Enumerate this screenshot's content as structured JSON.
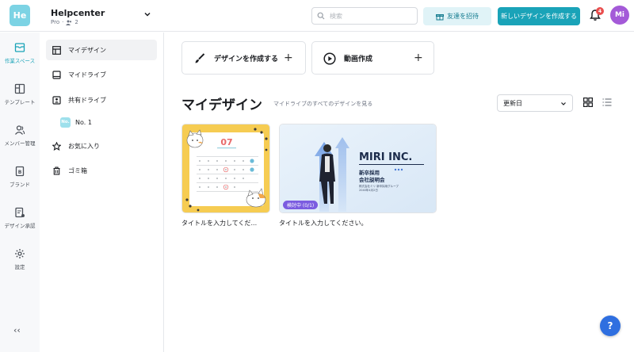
{
  "workspace": {
    "logo": "He",
    "name": "Helpcenter",
    "plan": "Pro",
    "members": "2"
  },
  "header": {
    "search_placeholder": "検索",
    "invite_label": "友達を招待",
    "create_label": "新しいデザインを作成する",
    "notification_count": "4",
    "avatar_initials": "Mi"
  },
  "rail": {
    "items": [
      {
        "label": "作業スペース",
        "icon": "inbox-icon",
        "active": true
      },
      {
        "label": "テンプレート",
        "icon": "template-icon"
      },
      {
        "label": "メンバー管理",
        "icon": "members-icon"
      },
      {
        "label": "ブランド",
        "icon": "brand-icon"
      },
      {
        "label": "デザイン承認",
        "icon": "approval-icon"
      },
      {
        "label": "設定",
        "icon": "gear-icon"
      }
    ],
    "collapse_label": "‹‹"
  },
  "sidenav": {
    "items": [
      {
        "label": "マイデザイン",
        "icon": "grid-icon",
        "active": true
      },
      {
        "label": "マイドライブ",
        "icon": "drive-icon"
      },
      {
        "label": "共有ドライブ",
        "icon": "shared-drive-icon"
      },
      {
        "label": "お気に入り",
        "icon": "star-icon"
      },
      {
        "label": "ゴミ箱",
        "icon": "trash-icon"
      }
    ],
    "shared_sub": {
      "chip": "No.",
      "label": "No. 1"
    }
  },
  "main": {
    "create_design_label": "デザインを作成する",
    "create_video_label": "動画作成",
    "title": "マイデザイン",
    "subtitle": "マイドライブのすべてのデザインを見る",
    "sort_label": "更新日",
    "designs": [
      {
        "caption": "タイトルを入力してくだ...",
        "calendar_month": "07"
      },
      {
        "caption": "タイトルを入力してください。",
        "badge": "検討中 (0/1)",
        "logo_text": "MIRI INC.",
        "headline_1": "新卒採用",
        "headline_2": "会社説明会",
        "small_1": "株式会社ミリ 新卒採用グループ",
        "small_2": "2040年4月2日"
      }
    ]
  },
  "help_label": "?",
  "colors": {
    "accent": "#1aa3b8",
    "avatar": "#a45ad8",
    "badge": "#7b5ce0",
    "notification": "#ea4e4e"
  }
}
